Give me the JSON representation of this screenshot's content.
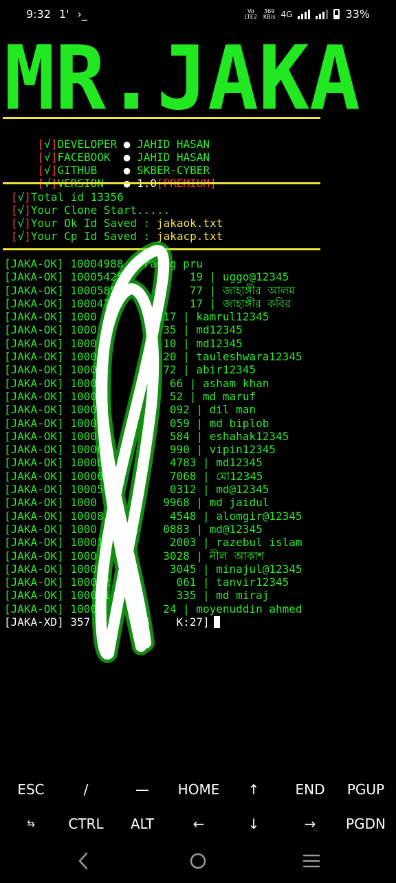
{
  "status_bar": {
    "time": "9:32",
    "icon_1": "1'",
    "icon_2": "›_",
    "volte": "Vo LTE2",
    "speed_value": "369",
    "speed_unit": "KB/s",
    "network": "4G",
    "battery": "33%"
  },
  "banner": {
    "title": "MR.JAKA"
  },
  "info": [
    {
      "bracket_open": "[",
      "check": "√",
      "bracket_close": "]",
      "label": "DEVELOPER",
      "value": "JAHID HASAN"
    },
    {
      "bracket_open": "[",
      "check": "√",
      "bracket_close": "]",
      "label": "FACEBOOK ",
      "value": "JAHID HASAN"
    },
    {
      "bracket_open": "[",
      "check": "√",
      "bracket_close": "]",
      "label": "GITHUB   ",
      "value": "SKBER-CYBER"
    },
    {
      "bracket_open": "[",
      "check": "√",
      "bracket_close": "]",
      "label": "VERSION  ",
      "value": "1.0",
      "extra": "[PREMIUM]"
    }
  ],
  "status_lines": [
    {
      "check": "√",
      "text": "Total id 13356"
    },
    {
      "check": "√",
      "text": "Your Clone Start....."
    },
    {
      "check": "√",
      "text": "Your Ok Id Saved : ",
      "file": "jakaok.txt"
    },
    {
      "check": "√",
      "text": "Your Cp Id Saved : ",
      "file": "jakacp.txt"
    }
  ],
  "results": [
    {
      "tag": "[JAKA-OK]",
      "id": "10004988",
      "pass": "raong pru"
    },
    {
      "tag": "[JAKA-OK]",
      "id": "10005425          19",
      "pass": "uggo@12345"
    },
    {
      "tag": "[JAKA-OK]",
      "id": "10005854          77",
      "pass": "জাহাঙ্গীর আলম"
    },
    {
      "tag": "[JAKA-OK]",
      "id": "10004755          17",
      "pass": "জাহাঙ্গীর কবির"
    },
    {
      "tag": "[JAKA-OK]",
      "id": "1000          17",
      "pass": "kamrul12345"
    },
    {
      "tag": "[JAKA-OK]",
      "id": "1000          35",
      "pass": "md12345"
    },
    {
      "tag": "[JAKA-OK]",
      "id": "1000          10",
      "pass": "md12345"
    },
    {
      "tag": "[JAKA-OK]",
      "id": "1000          20",
      "pass": "tauleshwara12345"
    },
    {
      "tag": "[JAKA-OK]",
      "id": "1000          72",
      "pass": "abir12345"
    },
    {
      "tag": "[JAKA-OK]",
      "id": "10008          66",
      "pass": "asham khan"
    },
    {
      "tag": "[JAKA-OK]",
      "id": "10008          52",
      "pass": "md maruf"
    },
    {
      "tag": "[JAKA-OK]",
      "id": "10007          092",
      "pass": "dil man"
    },
    {
      "tag": "[JAKA-OK]",
      "id": "10008          059",
      "pass": "md biplob"
    },
    {
      "tag": "[JAKA-OK]",
      "id": "10007          584",
      "pass": "eshahak12345"
    },
    {
      "tag": "[JAKA-OK]",
      "id": "10006          990",
      "pass": "vipin12345"
    },
    {
      "tag": "[JAKA-OK]",
      "id": "10006          4783",
      "pass": "md12345"
    },
    {
      "tag": "[JAKA-OK]",
      "id": "10006          7068",
      "pass": "মো12345"
    },
    {
      "tag": "[JAKA-OK]",
      "id": "10005          0312",
      "pass": "md@12345"
    },
    {
      "tag": "[JAKA-OK]",
      "id": "1000          9968",
      "pass": "md jaidul"
    },
    {
      "tag": "[JAKA-OK]",
      "id": "10008          4548",
      "pass": "alomgir@12345"
    },
    {
      "tag": "[JAKA-OK]",
      "id": "1000          0883",
      "pass": "md@12345"
    },
    {
      "tag": "[JAKA-OK]",
      "id": "10001          2003",
      "pass": "razebul islam"
    },
    {
      "tag": "[JAKA-OK]",
      "id": "1000          3028",
      "pass": "নীল আকাশ"
    },
    {
      "tag": "[JAKA-OK]",
      "id": "10008          3045",
      "pass": "minajul@12345"
    },
    {
      "tag": "[JAKA-OK]",
      "id": "100062          061",
      "pass": "tanvir12345"
    },
    {
      "tag": "[JAKA-OK]",
      "id": "100021          335",
      "pass": "md miraj"
    },
    {
      "tag": "[JAKA-OK]",
      "id": "1000          24",
      "pass": "moyenuddin ahmed"
    }
  ],
  "progress_line": "[JAKA-XD] 357       56    K:27]",
  "extra_keys": {
    "row1": [
      "ESC",
      "/",
      "—",
      "HOME",
      "↑",
      "END",
      "PGUP"
    ],
    "row2": [
      "⇆",
      "CTRL",
      "ALT",
      "←",
      "↓",
      "→",
      "PGDN"
    ]
  },
  "nav": {
    "back": "back-icon",
    "home": "home-icon",
    "recents": "recents-icon"
  },
  "colors": {
    "green": "#2ee82e",
    "yellow": "#f4e53c",
    "red": "#ff3b3b",
    "scribble_core": "#ffffff",
    "scribble_glow": "#21ff21"
  }
}
